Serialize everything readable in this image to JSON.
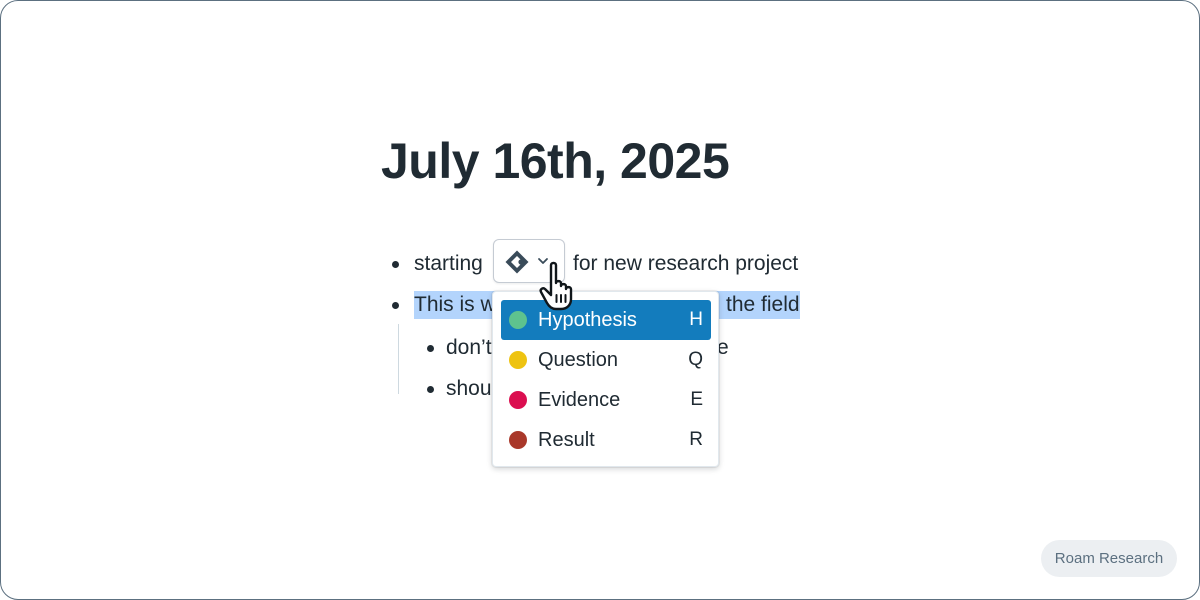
{
  "page": {
    "title": "July 16th, 2025"
  },
  "blocks": [
    {
      "prefix": "starting",
      "suffix": "for new research project"
    },
    {
      "prefix": "This is w",
      "suffix": "the field",
      "highlighted": true
    },
    {
      "prefix": "don’t",
      "suffix": "e",
      "child": true
    },
    {
      "prefix": "shou",
      "child": true
    }
  ],
  "tag_menu": {
    "trigger_icon": "tag-icon",
    "chevron_icon": "chevron-down-icon",
    "items": [
      {
        "label": "Hypothesis",
        "shortcut": "H",
        "color": "#5ec28e",
        "active": true
      },
      {
        "label": "Question",
        "shortcut": "Q",
        "color": "#eec311"
      },
      {
        "label": "Evidence",
        "shortcut": "E",
        "color": "#db0f50"
      },
      {
        "label": "Result",
        "shortcut": "R",
        "color": "#a9382a"
      }
    ]
  },
  "cursor": {
    "icon": "hand-pointer-icon"
  },
  "branding": {
    "label": "Roam Research"
  },
  "colors": {
    "selection": "#b3d4fc",
    "active_item": "#137cbd",
    "text": "#202b33"
  }
}
